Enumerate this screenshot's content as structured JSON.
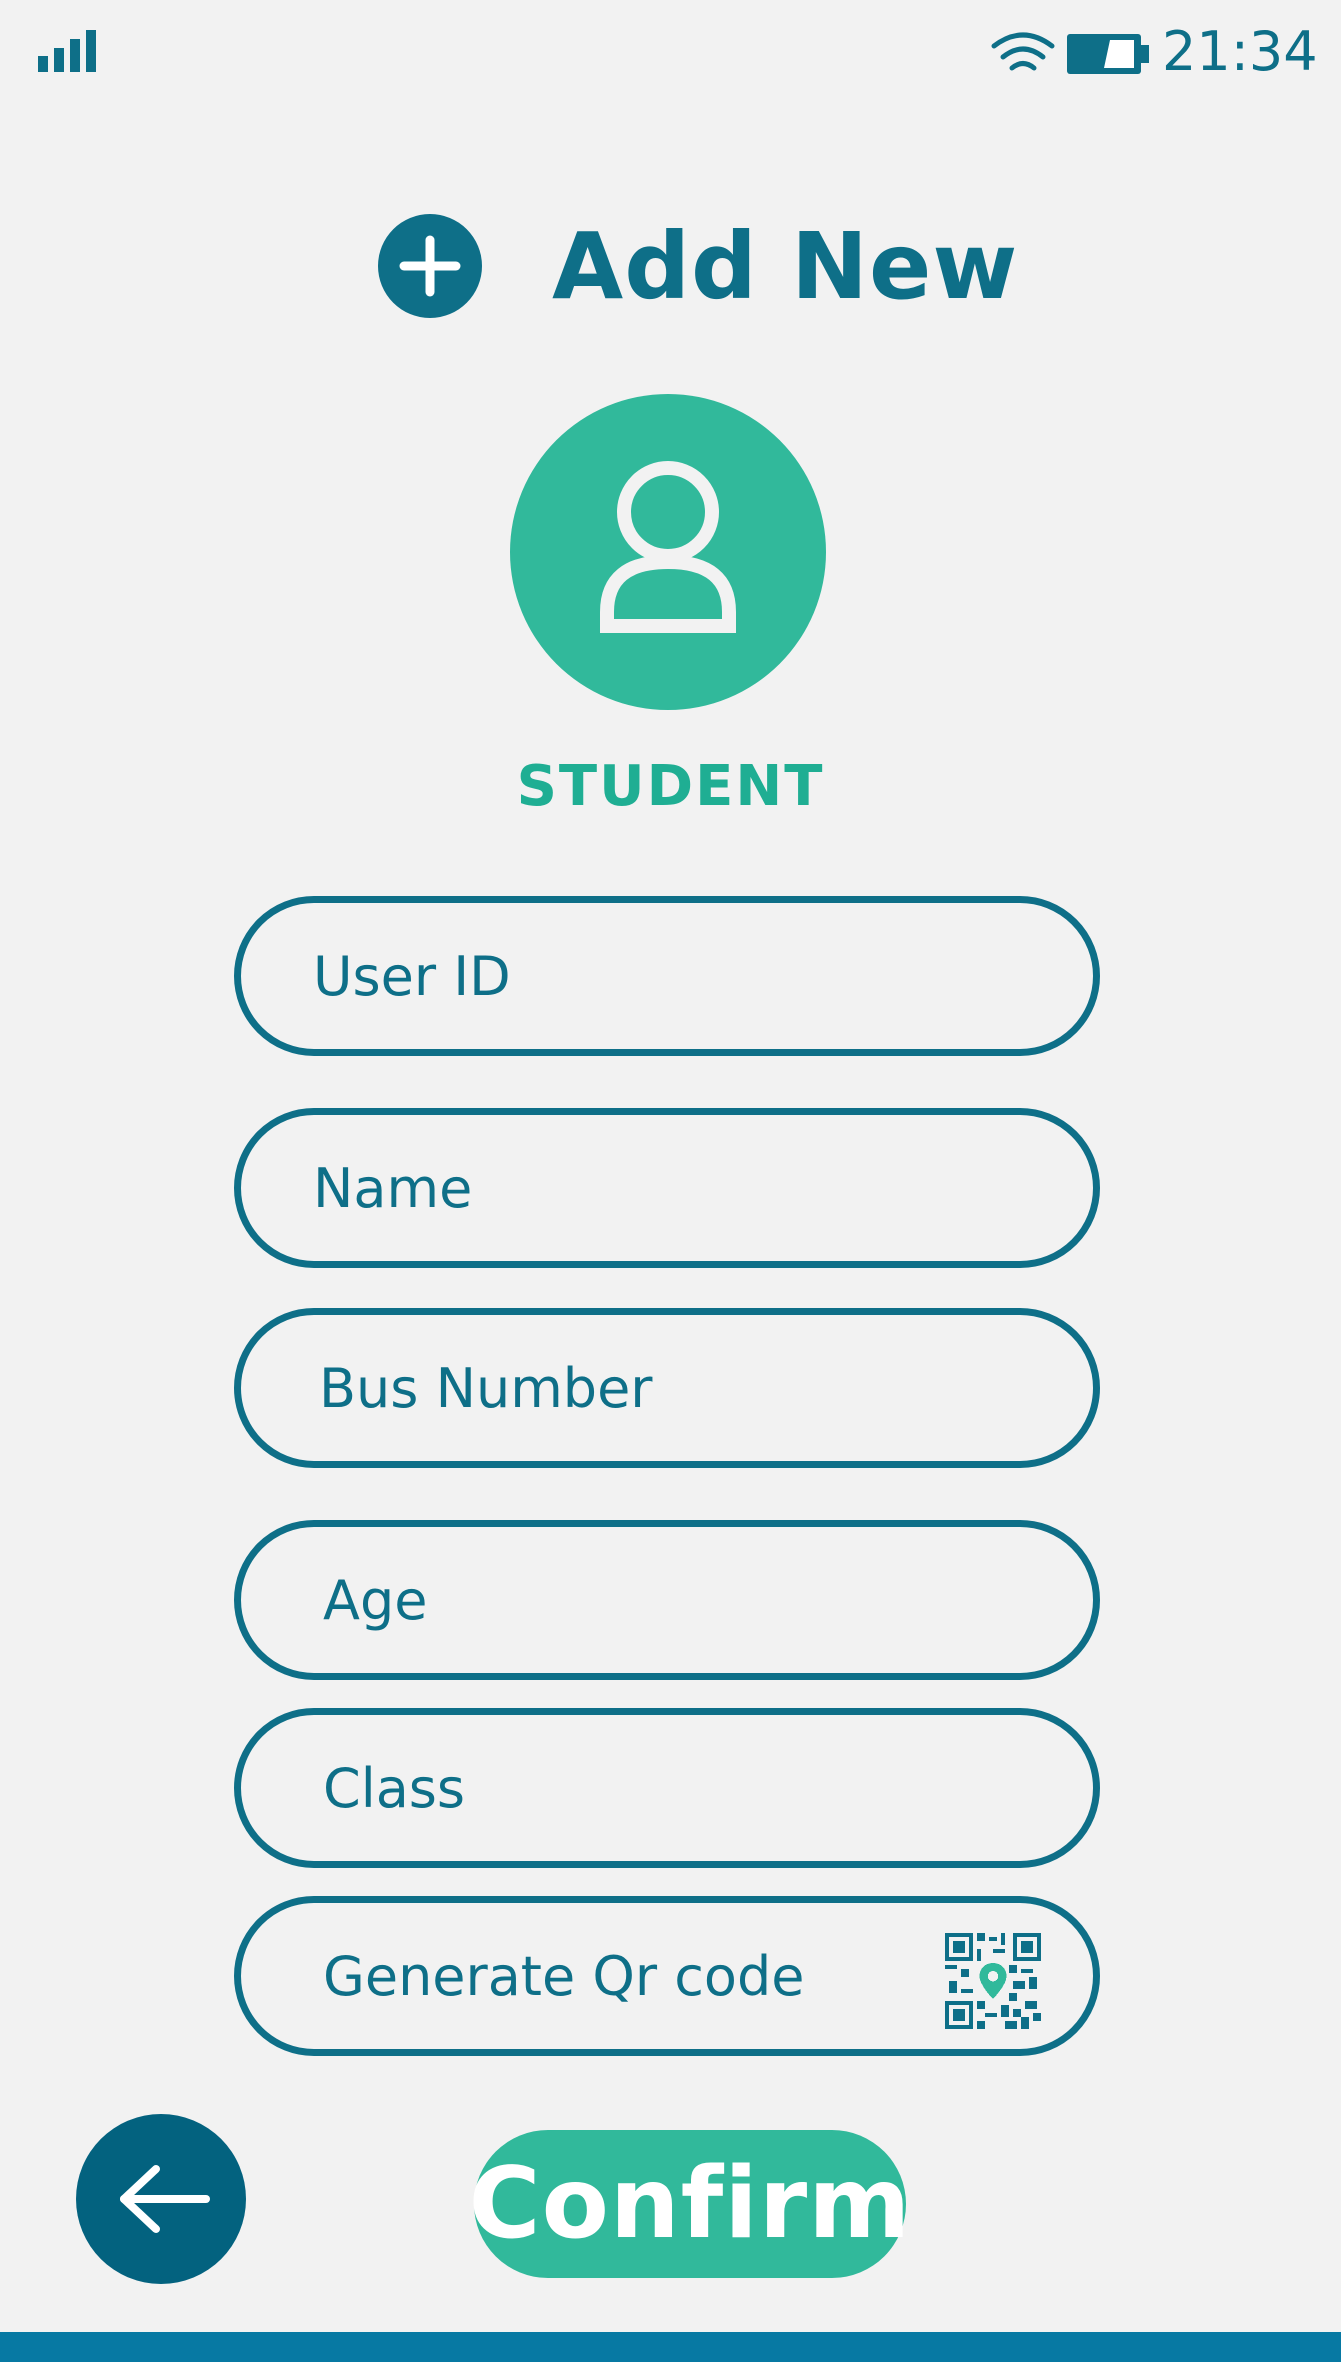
{
  "status_bar": {
    "time": "21:34"
  },
  "header": {
    "title": "Add New"
  },
  "profile": {
    "role_label": "STUDENT"
  },
  "form": {
    "fields": [
      {
        "label": "User ID"
      },
      {
        "label": "Name"
      },
      {
        "label": "Bus Number"
      },
      {
        "label": "Age"
      },
      {
        "label": "Class"
      },
      {
        "label": "Generate Qr code"
      }
    ]
  },
  "actions": {
    "confirm_label": "Confirm"
  },
  "icons": {
    "signal": "signal-strength-icon",
    "wifi": "wifi-icon",
    "battery": "battery-icon",
    "add": "plus-circle-icon",
    "avatar": "user-icon",
    "qr": "qr-code-icon",
    "back": "arrow-left-icon"
  },
  "colors": {
    "primary": "#0e6f88",
    "accent": "#31b99b",
    "back_button": "#03627f",
    "background": "#f2f2f2",
    "bottom_bar": "#0779a3"
  }
}
